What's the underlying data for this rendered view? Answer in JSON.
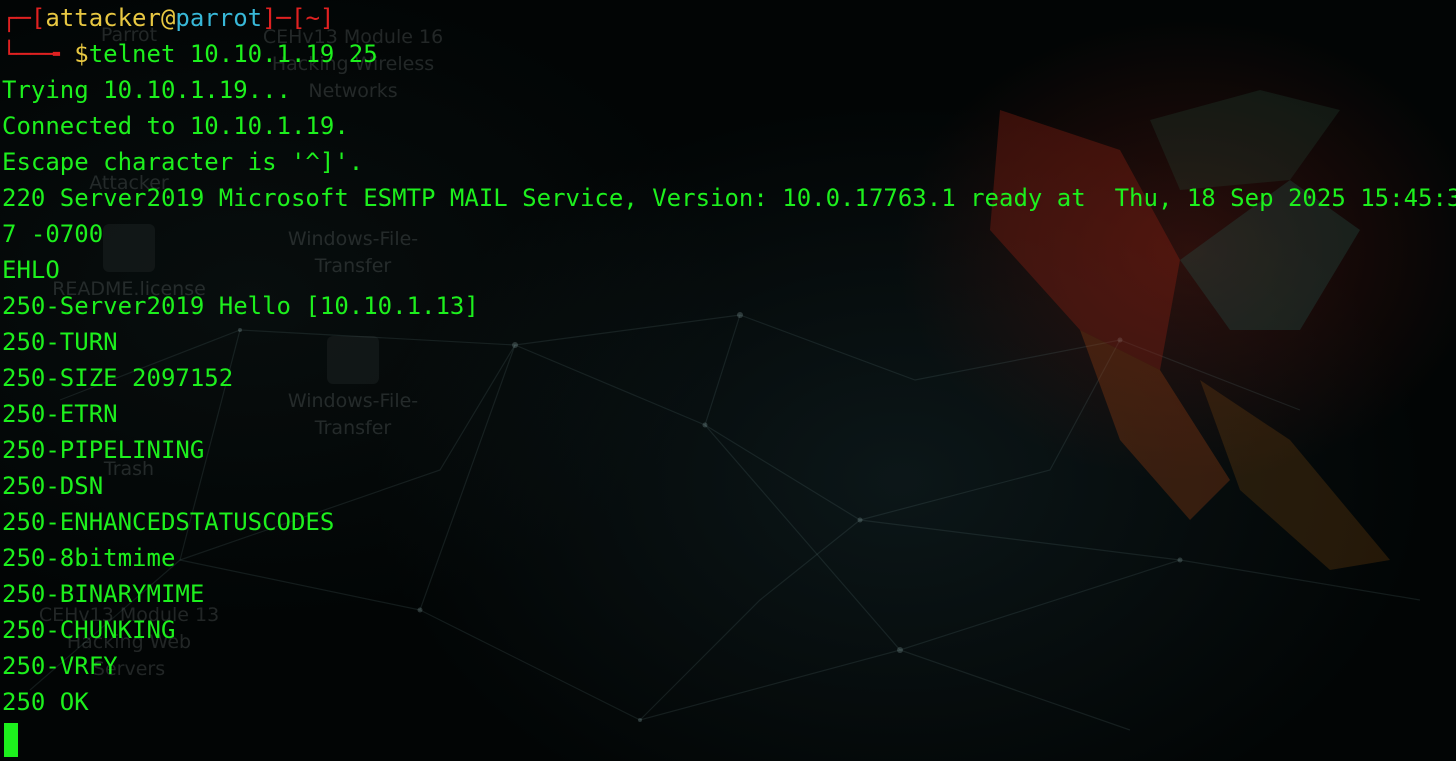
{
  "desktop": {
    "icons": [
      {
        "label": "Parrot"
      },
      {
        "label": "CEHv13 Module 16 Hacking Wireless Networks"
      },
      {
        "label": "Attacker"
      },
      {
        "label": "Windows-File-Transfer"
      },
      {
        "label": "README.license"
      },
      {
        "label": "Windows-File-Transfer"
      },
      {
        "label": "Trash"
      },
      {
        "label": "CEHv13 Module 13 Hacking Web Servers"
      }
    ]
  },
  "prompt": {
    "open_bracket": "┌─[",
    "user": "attacker",
    "at": "@",
    "host": "parrot",
    "mid": "]─[",
    "dir": "~",
    "close_bracket": "]",
    "corner": "└──╼ ",
    "dollar": "$",
    "command": "telnet 10.10.1.19 25"
  },
  "output_lines": [
    "Trying 10.10.1.19...",
    "Connected to 10.10.1.19.",
    "Escape character is '^]'.",
    "220 Server2019 Microsoft ESMTP MAIL Service, Version: 10.0.17763.1 ready at  Thu, 18 Sep 2025 15:45:3",
    "7 -0700",
    "EHLO",
    "250-Server2019 Hello [10.10.1.13]",
    "250-TURN",
    "250-SIZE 2097152",
    "250-ETRN",
    "250-PIPELINING",
    "250-DSN",
    "250-ENHANCEDSTATUSCODES",
    "250-8bitmime",
    "250-BINARYMIME",
    "250-CHUNKING",
    "250-VRFY",
    "250 OK"
  ],
  "colors": {
    "terminal_text": "#1df01d",
    "prompt_bracket": "#e02121",
    "prompt_user": "#e8c842",
    "prompt_host": "#38b8d8",
    "background": "#020505"
  }
}
